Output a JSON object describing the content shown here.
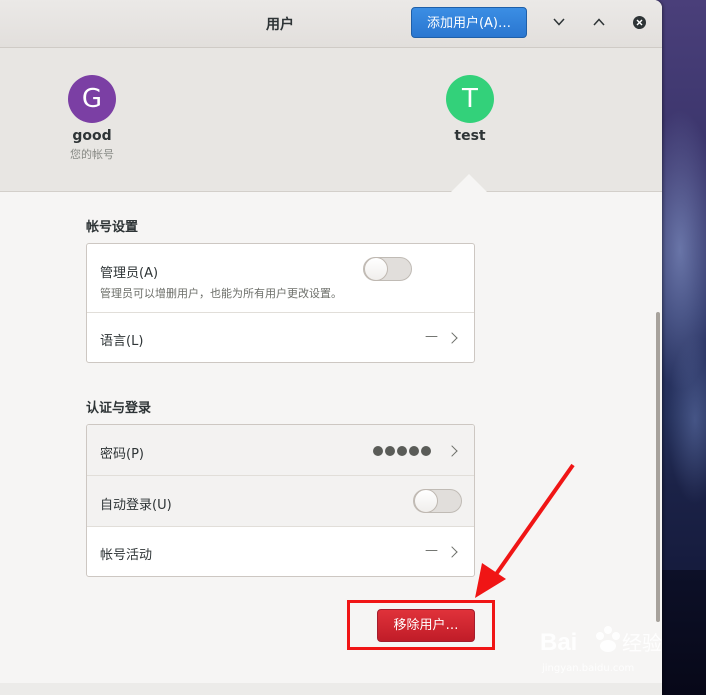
{
  "window": {
    "title": "用户",
    "add_user_label": "添加用户(A)…"
  },
  "users": [
    {
      "initial": "G",
      "name": "good",
      "subtitle": "您的帐号",
      "color": "#7b3fa4"
    },
    {
      "initial": "T",
      "name": "test",
      "subtitle": "",
      "color": "#33d17a"
    }
  ],
  "account_settings": {
    "title": "帐号设置",
    "admin": {
      "label": "管理员(A)",
      "description": "管理员可以增删用户，也能为所有用户更改设置。",
      "enabled": false
    },
    "language": {
      "label": "语言(L)",
      "value": "—"
    }
  },
  "auth": {
    "title": "认证与登录",
    "password": {
      "label": "密码(P)",
      "value": "●●●●●"
    },
    "autologin": {
      "label": "自动登录(U)",
      "enabled": false
    },
    "activity": {
      "label": "帐号活动",
      "value": "—"
    }
  },
  "remove_user_label": "移除用户…",
  "watermark": {
    "logo": "Baidu 经验",
    "url": "jingyan.baidu.com"
  },
  "colors": {
    "accent": "#3584e4",
    "destructive": "#c01c28",
    "annotation": "#f01515"
  }
}
